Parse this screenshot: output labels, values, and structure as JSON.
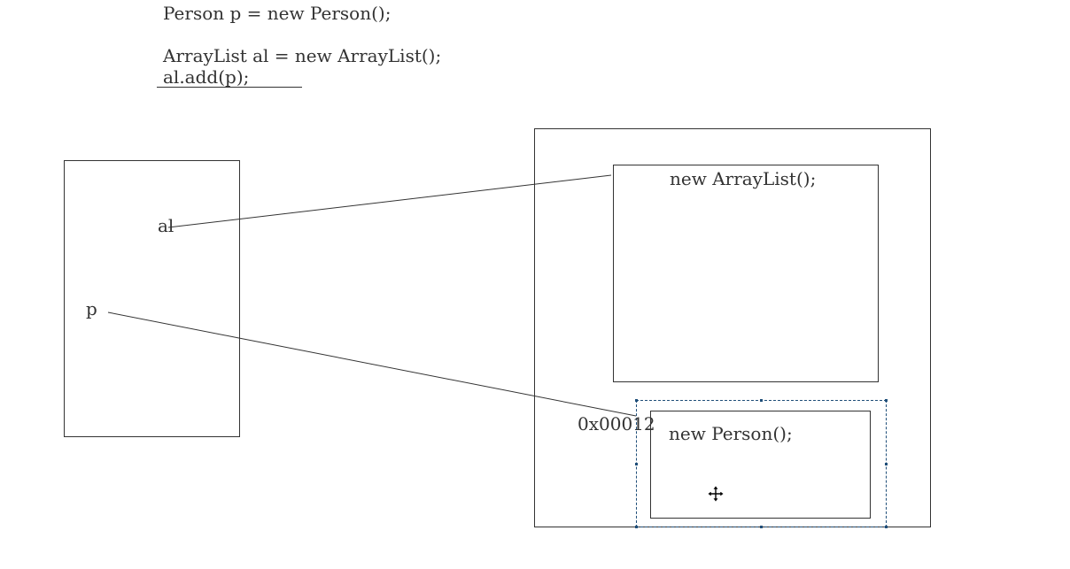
{
  "code": {
    "line1": "Person p = new Person();",
    "line2": "ArrayList al = new ArrayList();",
    "line3": "al.add(p);"
  },
  "stack": {
    "var_al": "al",
    "var_p": "p"
  },
  "heap": {
    "arraylist_label": "new ArrayList();",
    "person_label": "new Person();",
    "address_label": "0x00012"
  },
  "icons": {
    "move_cursor": "move-cursor-icon"
  },
  "colors": {
    "ink": "#333333",
    "selection": "#1f4e79"
  }
}
